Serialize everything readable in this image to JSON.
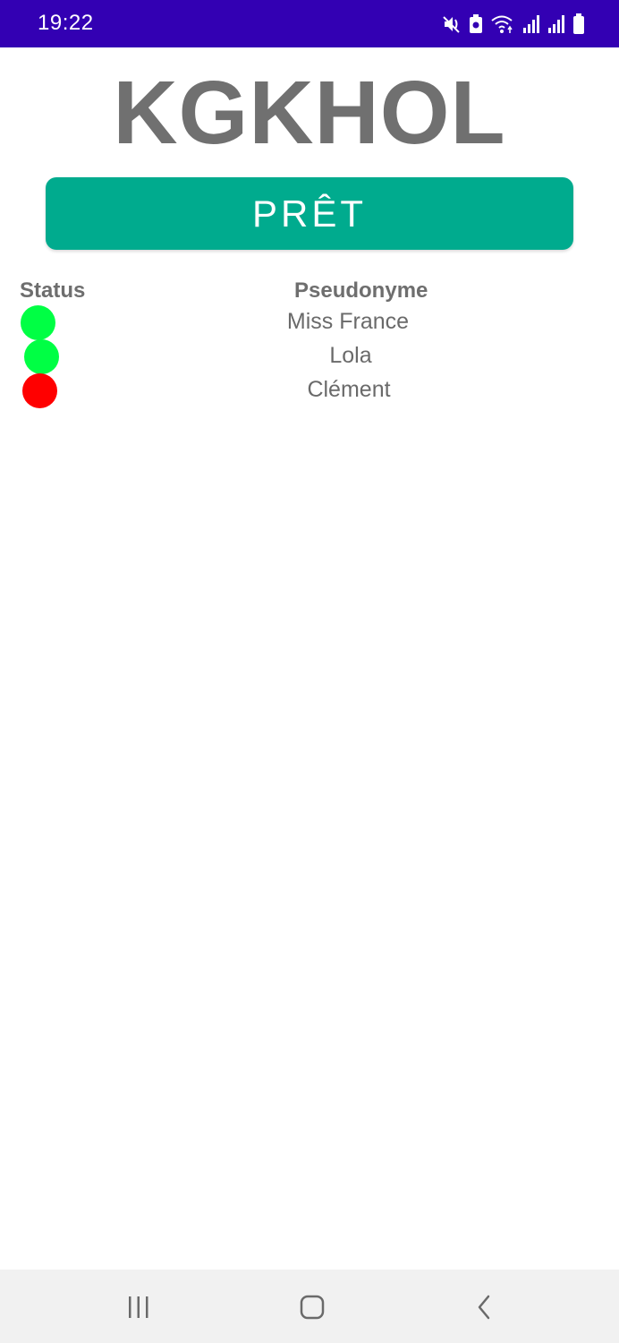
{
  "status_bar": {
    "time": "19:22",
    "background": "#3300b3",
    "icons": [
      "mute-icon",
      "battery-saver-icon",
      "wifi-icon",
      "signal-icon",
      "signal-icon-2",
      "battery-icon"
    ]
  },
  "app": {
    "title": "KGKHOL",
    "ready_button": "PRÊT",
    "accent": "#00ab8e"
  },
  "players_table": {
    "headers": {
      "status": "Status",
      "pseudonyme": "Pseudonyme"
    },
    "rows": [
      {
        "pseudonyme": "Miss France",
        "status": "ready",
        "status_color": "#00ff44"
      },
      {
        "pseudonyme": "Lola",
        "status": "ready",
        "status_color": "#00ff44"
      },
      {
        "pseudonyme": "Clément",
        "status": "not-ready",
        "status_color": "#ff0000"
      }
    ]
  },
  "nav_bar": {
    "buttons": [
      "recent-apps-icon",
      "home-icon",
      "back-icon"
    ]
  }
}
